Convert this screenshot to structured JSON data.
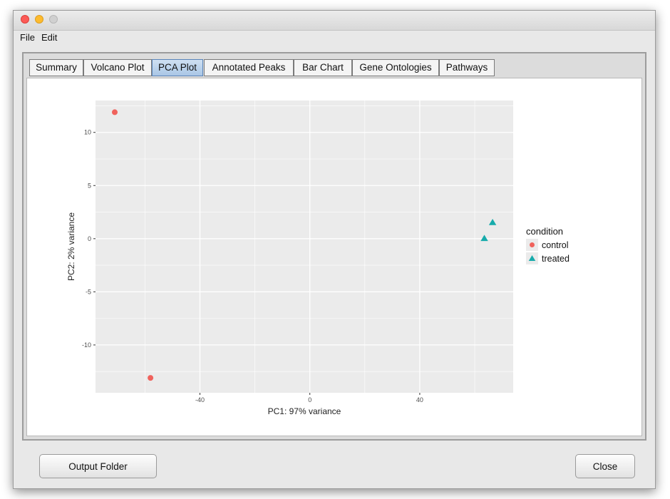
{
  "menu": {
    "file": "File",
    "edit": "Edit"
  },
  "tabs": [
    {
      "label": "Summary"
    },
    {
      "label": "Volcano Plot"
    },
    {
      "label": "PCA Plot"
    },
    {
      "label": "Annotated Peaks"
    },
    {
      "label": "Bar Chart"
    },
    {
      "label": "Gene Ontologies"
    },
    {
      "label": "Pathways"
    }
  ],
  "active_tab": "PCA Plot",
  "buttons": {
    "output_folder": "Output Folder",
    "close": "Close"
  },
  "colors": {
    "control": "#f0625c",
    "treated": "#17abab",
    "plot_bg": "#ebebeb",
    "grid": "#ffffff",
    "active_tab": "#a9c6e6"
  },
  "chart_data": {
    "type": "scatter",
    "xlabel": "PC1: 97% variance",
    "ylabel": "PC2: 2% variance",
    "xlim": [
      -78,
      74
    ],
    "ylim": [
      -14.5,
      13
    ],
    "xticks": [
      -40,
      0,
      40
    ],
    "yticks": [
      -10,
      -5,
      0,
      5,
      10
    ],
    "grid": true,
    "legend": {
      "title": "condition",
      "position": "right",
      "entries": [
        "control",
        "treated"
      ]
    },
    "series": [
      {
        "name": "control",
        "shape": "circle",
        "points": [
          [
            -71,
            11.9
          ],
          [
            -58,
            -13.1
          ]
        ]
      },
      {
        "name": "treated",
        "shape": "triangle",
        "points": [
          [
            63.5,
            0
          ],
          [
            66.5,
            1.5
          ]
        ]
      }
    ]
  }
}
